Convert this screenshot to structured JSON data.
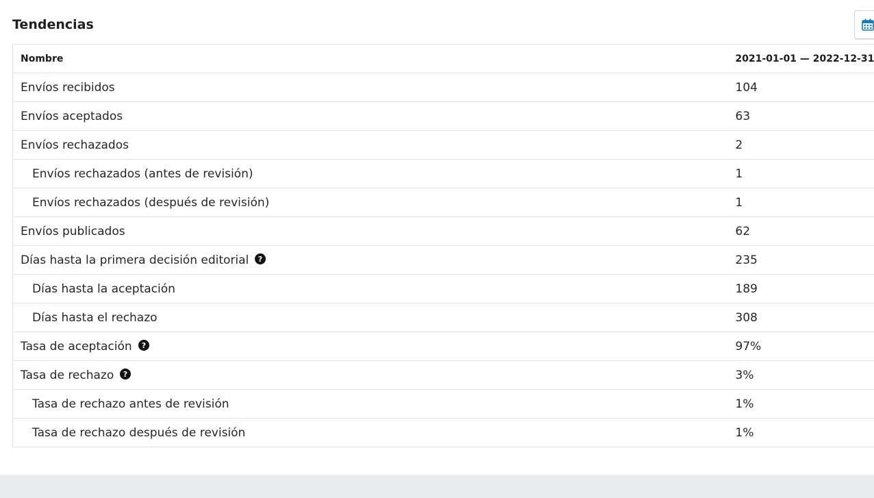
{
  "page": {
    "title": "Tendencias"
  },
  "toolbar": {
    "calendar_icon": "calendar-icon",
    "calendar_color": "#1a7ab8"
  },
  "table": {
    "headers": {
      "name": "Nombre",
      "range": "2021-01-01 — 2022-12-31"
    },
    "rows": [
      {
        "label": "Envíos recibidos",
        "value": "104",
        "sub": false,
        "help": false
      },
      {
        "label": "Envíos aceptados",
        "value": "63",
        "sub": false,
        "help": false
      },
      {
        "label": "Envíos rechazados",
        "value": "2",
        "sub": false,
        "help": false
      },
      {
        "label": "Envíos rechazados (antes de revisión)",
        "value": "1",
        "sub": true,
        "help": false
      },
      {
        "label": "Envíos rechazados (después de revisión)",
        "value": "1",
        "sub": true,
        "help": false
      },
      {
        "label": "Envíos publicados",
        "value": "62",
        "sub": false,
        "help": false
      },
      {
        "label": "Días hasta la primera decisión editorial",
        "value": "235",
        "sub": false,
        "help": true
      },
      {
        "label": "Días hasta la aceptación",
        "value": "189",
        "sub": true,
        "help": false
      },
      {
        "label": "Días hasta el rechazo",
        "value": "308",
        "sub": true,
        "help": false
      },
      {
        "label": "Tasa de aceptación",
        "value": "97%",
        "sub": false,
        "help": true
      },
      {
        "label": "Tasa de rechazo",
        "value": "3%",
        "sub": false,
        "help": true
      },
      {
        "label": "Tasa de rechazo antes de revisión",
        "value": "1%",
        "sub": true,
        "help": false
      },
      {
        "label": "Tasa de rechazo después de revisión",
        "value": "1%",
        "sub": true,
        "help": false
      }
    ]
  }
}
